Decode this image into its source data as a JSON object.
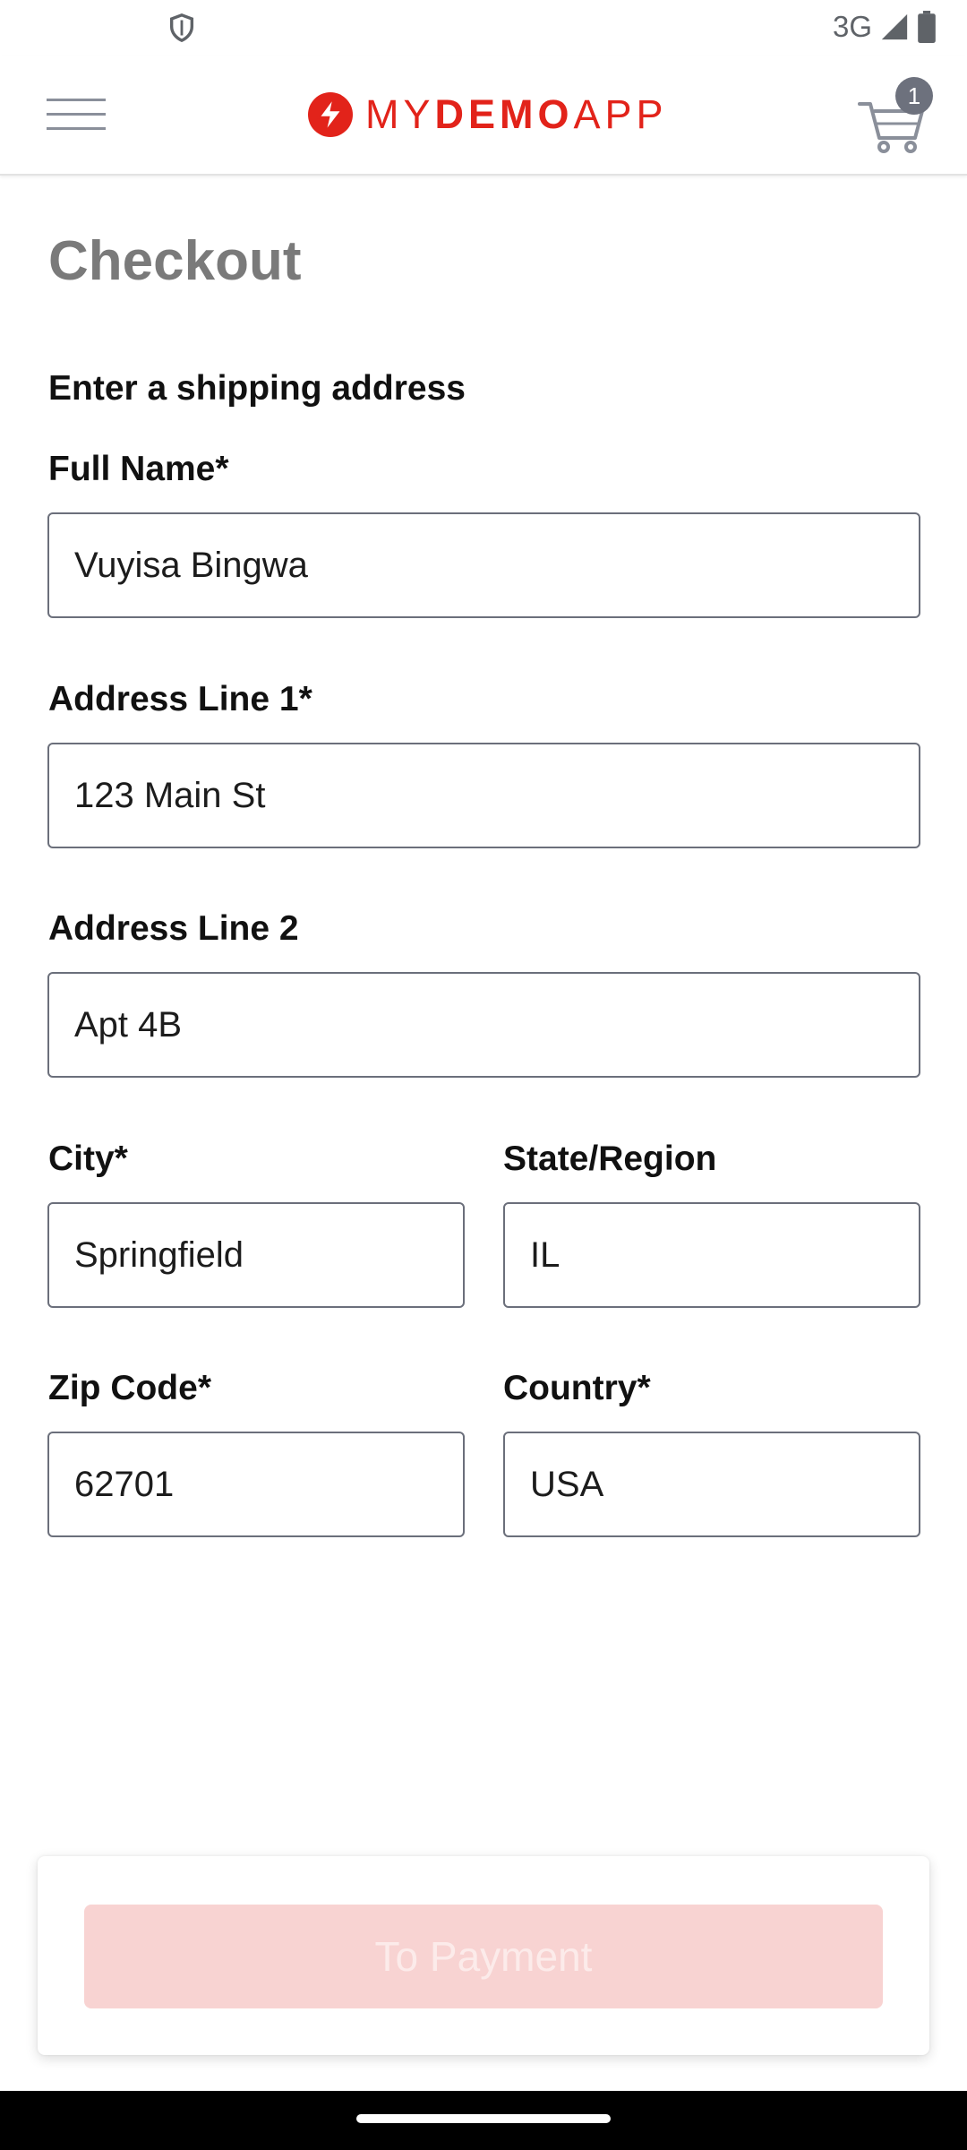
{
  "status_bar": {
    "network": "3G",
    "icons": [
      "shield-icon",
      "signal-icon",
      "battery-icon"
    ]
  },
  "header": {
    "logo": {
      "part1": "MY",
      "part2": "DEMO",
      "part3": "APP",
      "brand_color": "#e2231a"
    },
    "cart_count": "1",
    "icons": [
      "menu-icon",
      "logo-bolt-icon",
      "cart-icon"
    ]
  },
  "page": {
    "title": "Checkout",
    "section_title": "Enter a shipping address"
  },
  "form": {
    "full_name": {
      "label": "Full Name*",
      "value": "Vuyisa Bingwa"
    },
    "address1": {
      "label": "Address Line 1*",
      "value": "123 Main St"
    },
    "address2": {
      "label": "Address Line 2",
      "value": "Apt 4B"
    },
    "city": {
      "label": "City*",
      "value": "Springfield"
    },
    "state": {
      "label": "State/Region",
      "value": "IL"
    },
    "zip": {
      "label": "Zip Code*",
      "value": "62701"
    },
    "country": {
      "label": "Country*",
      "value": "USA"
    }
  },
  "actions": {
    "to_payment": "To Payment"
  },
  "colors": {
    "title_gray": "#7a7a7a",
    "input_border": "#6b6f7b",
    "badge": "#6d717d",
    "button_disabled_bg": "#f8d3d2"
  }
}
